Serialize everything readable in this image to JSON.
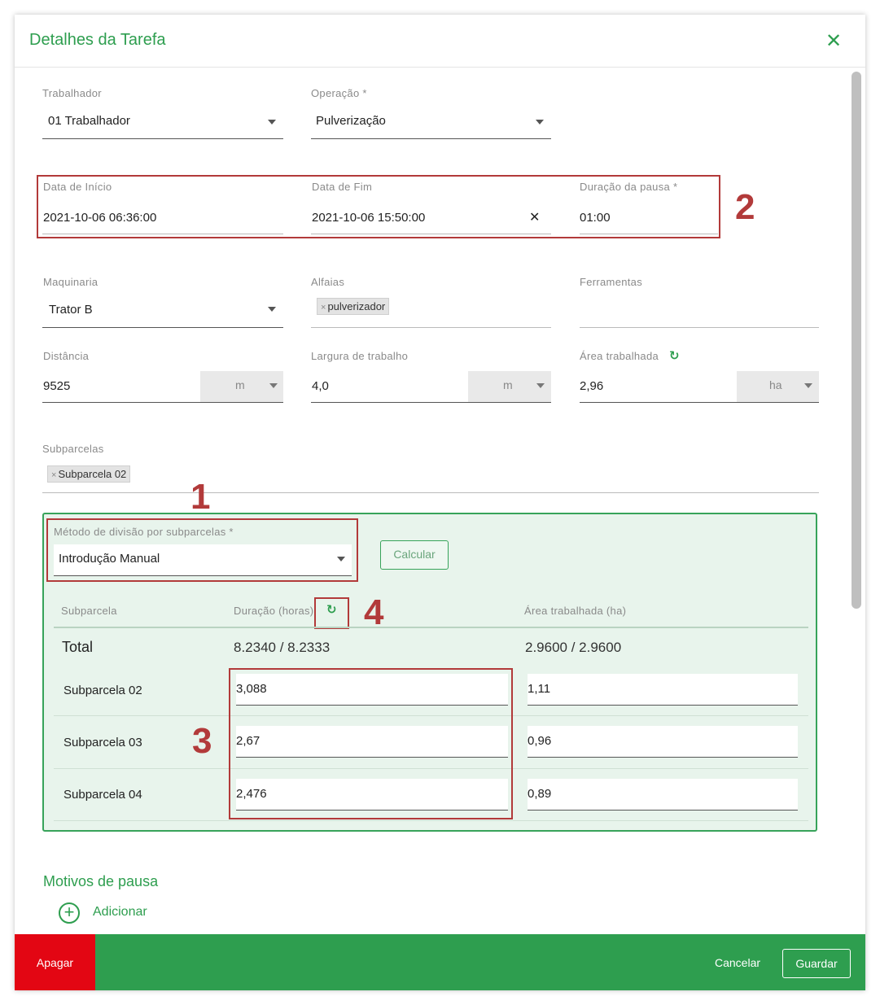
{
  "dialog": {
    "title": "Detalhes da Tarefa"
  },
  "fields": {
    "worker": {
      "label": "Trabalhador",
      "value": "01 Trabalhador"
    },
    "operation": {
      "label": "Operação *",
      "value": "Pulverização"
    },
    "start_date": {
      "label": "Data de Início",
      "value": "2021-10-06 06:36:00"
    },
    "end_date": {
      "label": "Data de Fim",
      "value": "2021-10-06 15:50:00"
    },
    "pause_duration": {
      "label": "Duração da pausa *",
      "value": "01:00"
    },
    "machinery": {
      "label": "Maquinaria",
      "value": "Trator B"
    },
    "implements": {
      "label": "Alfaias",
      "chips": [
        "pulverizador"
      ]
    },
    "tools": {
      "label": "Ferramentas",
      "value": ""
    },
    "distance": {
      "label": "Distância",
      "value": "9525",
      "unit": "m"
    },
    "work_width": {
      "label": "Largura de trabalho",
      "value": "4,0",
      "unit": "m"
    },
    "worked_area": {
      "label": "Área trabalhada",
      "value": "2,96",
      "unit": "ha"
    },
    "subplots": {
      "label": "Subparcelas",
      "chips": [
        "Subparcela 02"
      ]
    }
  },
  "division": {
    "method_label": "Método de divisão por subparcelas *",
    "method_value": "Introdução Manual",
    "calculate_label": "Calcular",
    "columns": {
      "subplot": "Subparcela",
      "duration": "Duração (horas)",
      "area": "Área trabalhada (ha)"
    },
    "total": {
      "label": "Total",
      "duration": "8.2340 / 8.2333",
      "area": "2.9600 / 2.9600"
    },
    "rows": [
      {
        "name": "Subparcela 02",
        "duration": "3,088",
        "area": "1,11"
      },
      {
        "name": "Subparcela 03",
        "duration": "2,67",
        "area": "0,96"
      },
      {
        "name": "Subparcela 04",
        "duration": "2,476",
        "area": "0,89"
      }
    ]
  },
  "pause_reasons": {
    "title": "Motivos de pausa",
    "add_label": "Adicionar"
  },
  "footer": {
    "delete_label": "Apagar",
    "cancel_label": "Cancelar",
    "save_label": "Guardar"
  },
  "annotations": {
    "one": "1",
    "two": "2",
    "three": "3",
    "four": "4"
  },
  "colors": {
    "accent": "#2e9e4f",
    "danger": "#e30613",
    "annotation": "#b23a3a",
    "panel_bg": "#e8f4ec"
  }
}
